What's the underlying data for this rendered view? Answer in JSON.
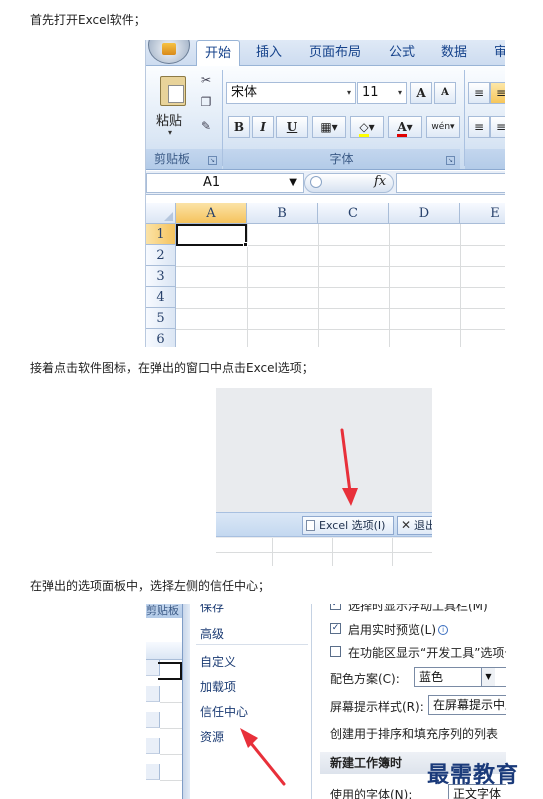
{
  "steps": [
    "首先打开Excel软件；",
    "接着点击软件图标，在弹出的窗口中点击Excel选项；",
    "在弹出的选项面板中，选择左侧的信任中心；"
  ],
  "excel": {
    "tabs": [
      "开始",
      "插入",
      "页面布局",
      "公式",
      "数据",
      "审"
    ],
    "active_tab": "开始",
    "clipboard": {
      "paste_label": "粘贴",
      "group_label": "剪贴板"
    },
    "font": {
      "font_name": "宋体",
      "font_size": "11",
      "grow_label": "A",
      "shrink_label": "A",
      "bold": "B",
      "italic": "I",
      "underline": "U",
      "font_color_label": "A",
      "phonetic_label": "wén",
      "group_label": "字体"
    },
    "name_box": "A1",
    "fx_label": "fx",
    "columns": [
      "A",
      "B",
      "C",
      "D",
      "E"
    ],
    "rows": [
      "1",
      "2",
      "3",
      "4",
      "5",
      "6"
    ],
    "selected_cell": "A1"
  },
  "office_menu": {
    "options_button": "Excel 选项(I)",
    "exit_button": "退出"
  },
  "options_dialog": {
    "background_tab": "剪贴板",
    "nav_items": [
      "保存",
      "高级",
      "自定义",
      "加载项",
      "信任中心",
      "资源"
    ],
    "checkbox_top": "选择时显示浮动工具栏(M)",
    "checkbox_live_preview": "启用实时预览(L)",
    "checkbox_devtools": "在功能区显示“开发工具”选项卡",
    "color_scheme_label": "配色方案(C):",
    "color_scheme_value": "蓝色",
    "screentip_label": "屏幕提示样式(R):",
    "screentip_value": "在屏幕提示中显示功能说明",
    "sort_list_text": "创建用于排序和填充序列的列表",
    "section_new_workbook": "新建工作簿时",
    "font_label": "使用的字体(N):",
    "font_value": "正文字体"
  },
  "watermark": "最需教育",
  "colors": {
    "arrow": "#e8303a",
    "ribbon_text": "#15428b"
  }
}
